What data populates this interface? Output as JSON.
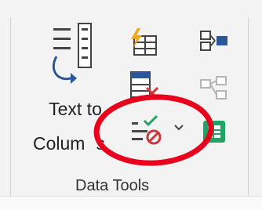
{
  "group": {
    "label": "Data Tools"
  },
  "text_to_columns": {
    "label_line1": "Text to",
    "label_line2": "Colum",
    "label_tail": "s",
    "icon": "text-to-columns-icon"
  },
  "buttons": {
    "flash_fill": {
      "icon": "flash-fill-icon"
    },
    "remove_duplicates": {
      "icon": "remove-duplicates-icon"
    },
    "data_validation": {
      "icon": "data-validation-icon"
    },
    "data_validation_dropdown": {
      "icon": "chevron-down-icon"
    },
    "consolidate": {
      "icon": "consolidate-icon"
    },
    "relationships": {
      "icon": "relationships-icon"
    },
    "manage_data_model": {
      "icon": "manage-data-model-icon"
    }
  },
  "colors": {
    "icon_blue": "#2b579a",
    "icon_green": "#21a366",
    "icon_red": "#d13438",
    "flash_orange": "#f7a41d",
    "annotation_red": "#e8001c"
  }
}
